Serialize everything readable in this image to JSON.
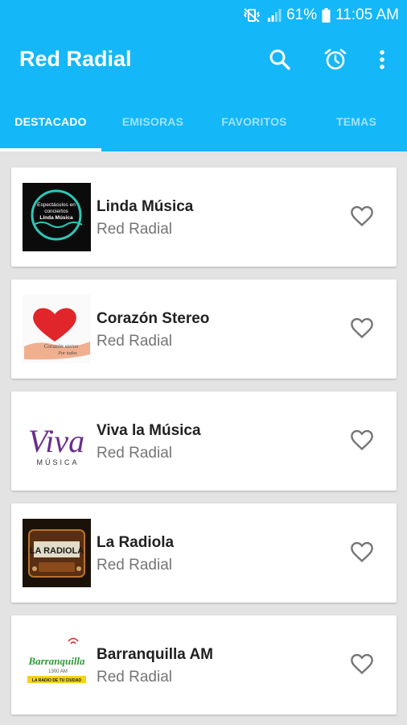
{
  "status_bar": {
    "battery": "61%",
    "time": "11:05 AM",
    "icons": [
      "vibrate-off-icon",
      "signal-icon",
      "battery-icon"
    ]
  },
  "app_bar": {
    "title": "Red Radial",
    "actions": [
      "search-icon",
      "alarm-icon",
      "more-vert-icon"
    ]
  },
  "tabs": [
    {
      "label": "DESTACADO",
      "active": true
    },
    {
      "label": "EMISORAS",
      "active": false
    },
    {
      "label": "FAVORITOS",
      "active": false
    },
    {
      "label": "TEMAS",
      "active": false
    }
  ],
  "stations": [
    {
      "name": "Linda Música",
      "network": "Red Radial",
      "logo_text": [
        "Espectáculos en",
        "conciertos",
        "Linda Música"
      ]
    },
    {
      "name": "Corazón Stereo",
      "network": "Red Radial",
      "logo_text": [
        "Corazón stereo",
        "Por todos"
      ]
    },
    {
      "name": "Viva la Música",
      "network": "Red Radial",
      "logo_text": [
        "Viva",
        "MÚSICA"
      ]
    },
    {
      "name": "La Radiola",
      "network": "Red Radial",
      "logo_text": [
        "LA RADIOLA"
      ]
    },
    {
      "name": "Barranquilla AM",
      "network": "Red Radial",
      "logo_text": [
        "Barranquilla",
        "1300 AM",
        "LA RADIO DE TU CIUDAD"
      ]
    }
  ],
  "colors": {
    "primary": "#14b7f7",
    "background": "#e3e3e3",
    "card": "#ffffff",
    "title_text": "#212121",
    "subtitle_text": "#757575",
    "heart_outline": "#757575"
  }
}
